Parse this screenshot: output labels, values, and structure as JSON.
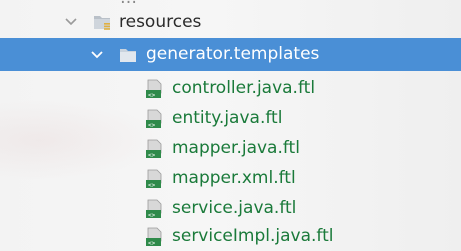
{
  "tree": {
    "partial_top": "…",
    "resources": {
      "label": "resources",
      "icon": "resources-folder-icon",
      "expanded": true
    },
    "package": {
      "label": "generator.templates",
      "icon": "package-folder-icon",
      "expanded": true,
      "selected": true
    },
    "files": [
      {
        "label": "controller.java.ftl",
        "icon": "ftl-template-file-icon"
      },
      {
        "label": "entity.java.ftl",
        "icon": "ftl-template-file-icon"
      },
      {
        "label": "mapper.java.ftl",
        "icon": "ftl-template-file-icon"
      },
      {
        "label": "mapper.xml.ftl",
        "icon": "ftl-template-file-icon"
      },
      {
        "label": "service.java.ftl",
        "icon": "ftl-template-file-icon"
      },
      {
        "label": "serviceImpl.java.ftl",
        "icon": "ftl-template-file-icon"
      }
    ]
  },
  "colors": {
    "selection": "#4a8fd6",
    "file_text": "#1a7a3a",
    "dir_text": "#2b2b2b",
    "background": "#f2f2f2"
  }
}
